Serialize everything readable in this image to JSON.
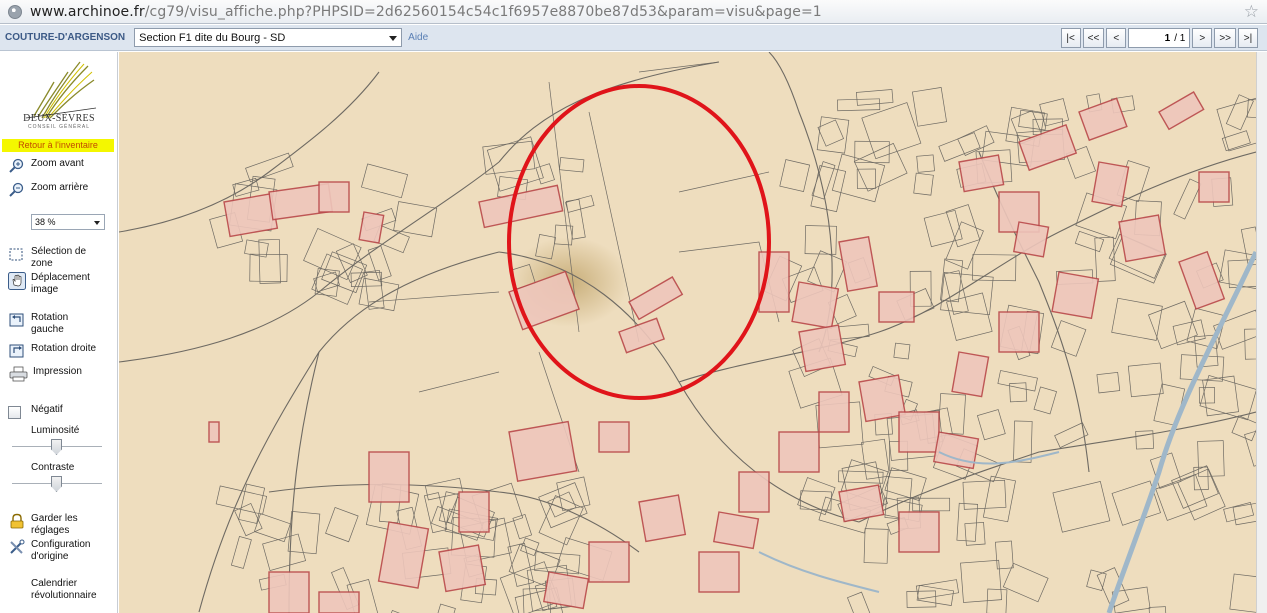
{
  "browser": {
    "url_host": "www.archinoe.fr",
    "url_path": "/cg79/visu_affiche.php?PHPSID=2d62560154c54c1f6957e8870be87d53&param=visu&page=1"
  },
  "toolbar": {
    "commune": "COUTURE-D'ARGENSON",
    "section_select": "Section F1 dite du Bourg - SD",
    "help_link": "Aide",
    "pager": {
      "first": "|<",
      "prev_fast": "<<",
      "prev": "<",
      "page_value": "1",
      "page_total": "/ 1",
      "next": ">",
      "next_fast": ">>",
      "last": ">|"
    }
  },
  "sidebar": {
    "logo_name": "DEUX-SÈVRES",
    "logo_sub": "CONSEIL GÉNÉRAL",
    "back_link": "Retour à l'inventaire",
    "zoom_in": "Zoom avant",
    "zoom_out": "Zoom arrière",
    "zoom_level": "38 %",
    "select_zone": "Sélection de zone",
    "pan_image": "Déplacement image",
    "rotate_left": "Rotation gauche",
    "rotate_right": "Rotation droite",
    "print": "Impression",
    "negative": "Négatif",
    "brightness": "Luminosité",
    "brightness_level": 0.5,
    "contrast": "Contraste",
    "contrast_level": 0.5,
    "keep_settings": "Garder les réglages",
    "reset_config": "Configuration d'origine",
    "calendar": "Calendrier révolutionnaire"
  },
  "colors": {
    "paper": "#f1e2c6",
    "ink": "#6e6a63",
    "parcel_fill": "#eec6bb",
    "parcel_edge": "#b9484a",
    "annotation_circle": "#e0141a",
    "river": "#9fb7c9"
  }
}
